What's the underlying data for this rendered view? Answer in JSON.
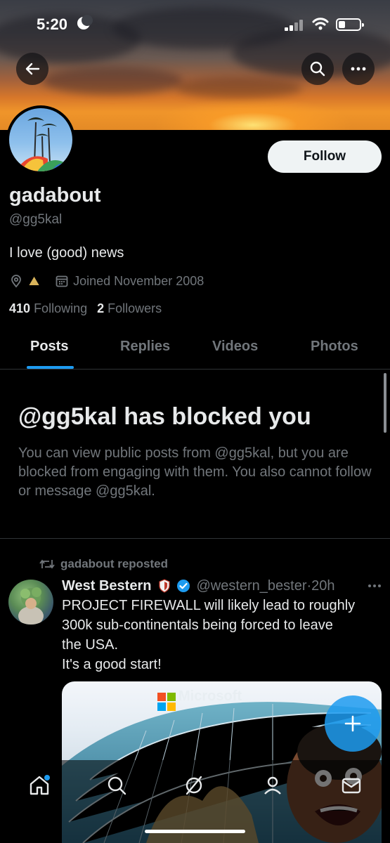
{
  "status_bar": {
    "time": "5:20"
  },
  "profile": {
    "display_name": "gadabout",
    "handle": "@gg5kal",
    "bio": "I love (good) news",
    "location_emoji": "⛰",
    "joined": "Joined November 2008",
    "following_count": "410",
    "following_label": "Following",
    "followers_count": "2",
    "followers_label": "Followers",
    "follow_button": "Follow"
  },
  "tabs": [
    {
      "label": "Posts",
      "active": true
    },
    {
      "label": "Replies",
      "active": false
    },
    {
      "label": "Videos",
      "active": false
    },
    {
      "label": "Photos",
      "active": false
    }
  ],
  "blocked": {
    "title": "@gg5kal has blocked you",
    "message": "You can view public posts from @gg5kal, but you are blocked from engaging with them. You also cannot follow or message @gg5kal."
  },
  "post": {
    "repost_label": "gadabout reposted",
    "author": "West Bestern",
    "author_handle": "@western_bester",
    "time": "·20h",
    "lines": [
      "PROJECT FIREWALL will likely lead to roughly",
      "300k sub-continentals being forced to leave",
      "the USA.",
      "It's a good start!"
    ],
    "media_text": "Microsoft"
  },
  "bottom_nav": [
    "home-icon",
    "search-icon",
    "grok-icon",
    "communities-icon",
    "messages-icon"
  ],
  "colors": {
    "accent": "#1d9bf0",
    "text": "#e7e9ea",
    "muted": "#71767b",
    "background": "#000000"
  }
}
